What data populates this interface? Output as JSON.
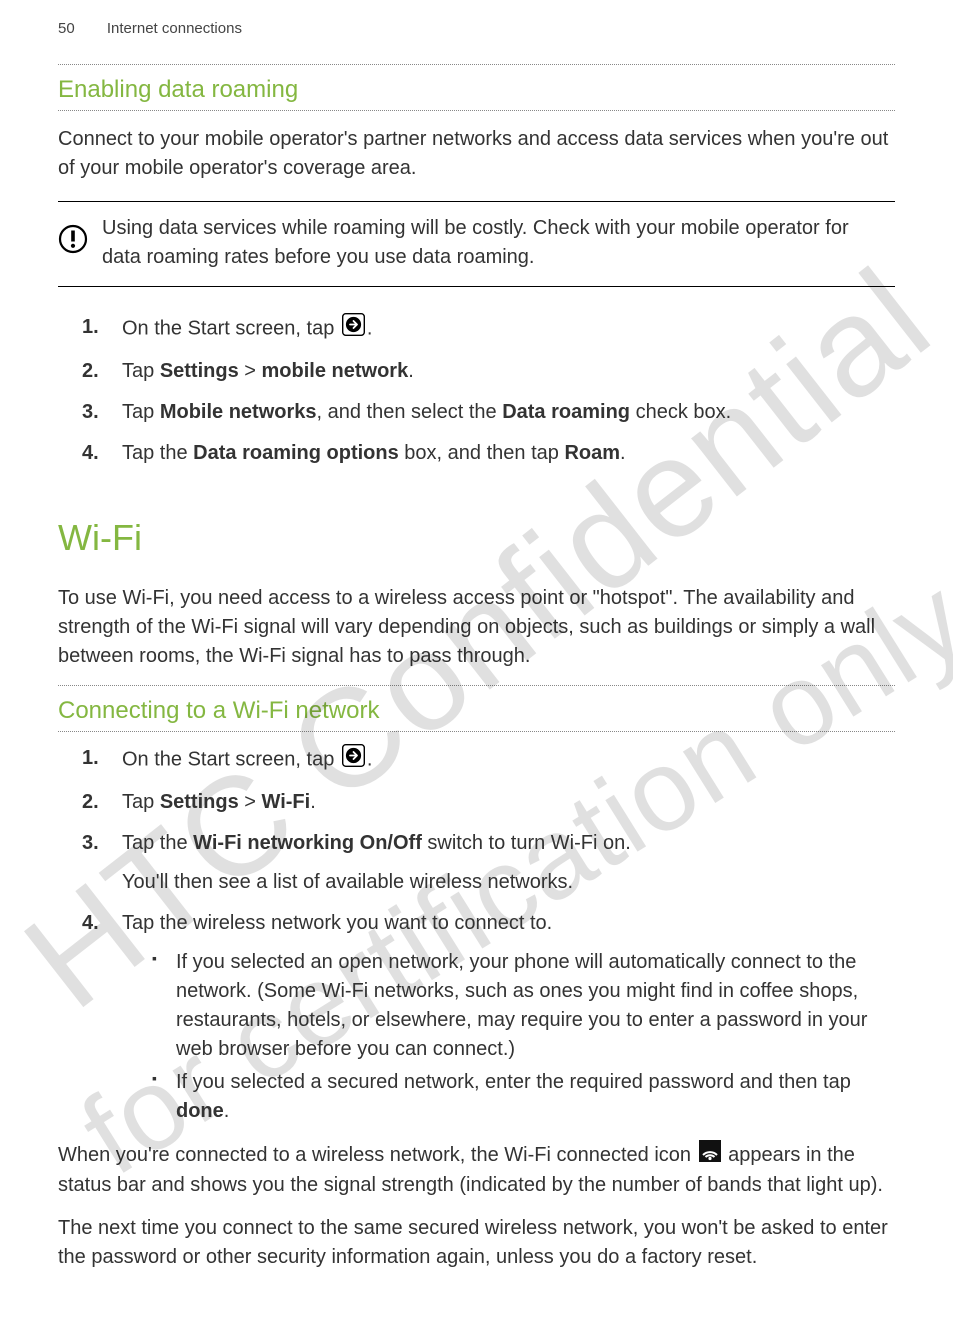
{
  "header": {
    "page_number": "50",
    "section": "Internet connections"
  },
  "watermarks": {
    "wm1": "HTC Confidential",
    "wm2": "for certification only"
  },
  "roaming": {
    "heading": "Enabling data roaming",
    "intro": "Connect to your mobile operator's partner networks and access data services when you're out of your mobile operator's coverage area.",
    "note": "Using data services while roaming will be costly. Check with your mobile operator for data roaming rates before you use data roaming.",
    "steps": {
      "s1_a": "On the Start screen, tap ",
      "s1_b": ".",
      "s2_a": "Tap ",
      "s2_b": "Settings",
      "s2_c": " > ",
      "s2_d": "mobile network",
      "s2_e": ".",
      "s3_a": "Tap ",
      "s3_b": "Mobile networks",
      "s3_c": ", and then select the ",
      "s3_d": "Data roaming",
      "s3_e": " check box.",
      "s4_a": "Tap the ",
      "s4_b": "Data roaming options",
      "s4_c": " box, and then tap ",
      "s4_d": "Roam",
      "s4_e": "."
    }
  },
  "wifi": {
    "heading": "Wi-Fi",
    "intro": "To use Wi-Fi, you need access to a wireless access point or \"hotspot\". The availability and strength of the Wi-Fi signal will vary depending on objects, such as buildings or simply a wall between rooms, the Wi-Fi signal has to pass through.",
    "sub_heading": "Connecting to a Wi-Fi network",
    "steps": {
      "s1_a": "On the Start screen, tap ",
      "s1_b": ".",
      "s2_a": "Tap ",
      "s2_b": "Settings",
      "s2_c": " > ",
      "s2_d": "Wi-Fi",
      "s2_e": ".",
      "s3_a": "Tap the ",
      "s3_b": "Wi-Fi networking On/Off",
      "s3_c": " switch to turn Wi-Fi on.",
      "s3_sub": "You'll then see a list of available wireless networks.",
      "s4": "Tap the wireless network you want to connect to.",
      "b1": "If you selected an open network, your phone will automatically connect to the network. (Some Wi-Fi networks, such as ones you might find in coffee shops, restaurants, hotels, or elsewhere, may require you to enter a password in your web browser before you can connect.)",
      "b2_a": "If you selected a secured network, enter the required password and then tap ",
      "b2_b": "done",
      "b2_c": "."
    },
    "para1_a": "When you're connected to a wireless network, the Wi-Fi connected icon ",
    "para1_b": " appears in the status bar and shows you the signal strength (indicated by the number of bands that light up).",
    "para2": "The next time you connect to the same secured wireless network, you won't be asked to enter the password or other security information again, unless you do a factory reset."
  }
}
